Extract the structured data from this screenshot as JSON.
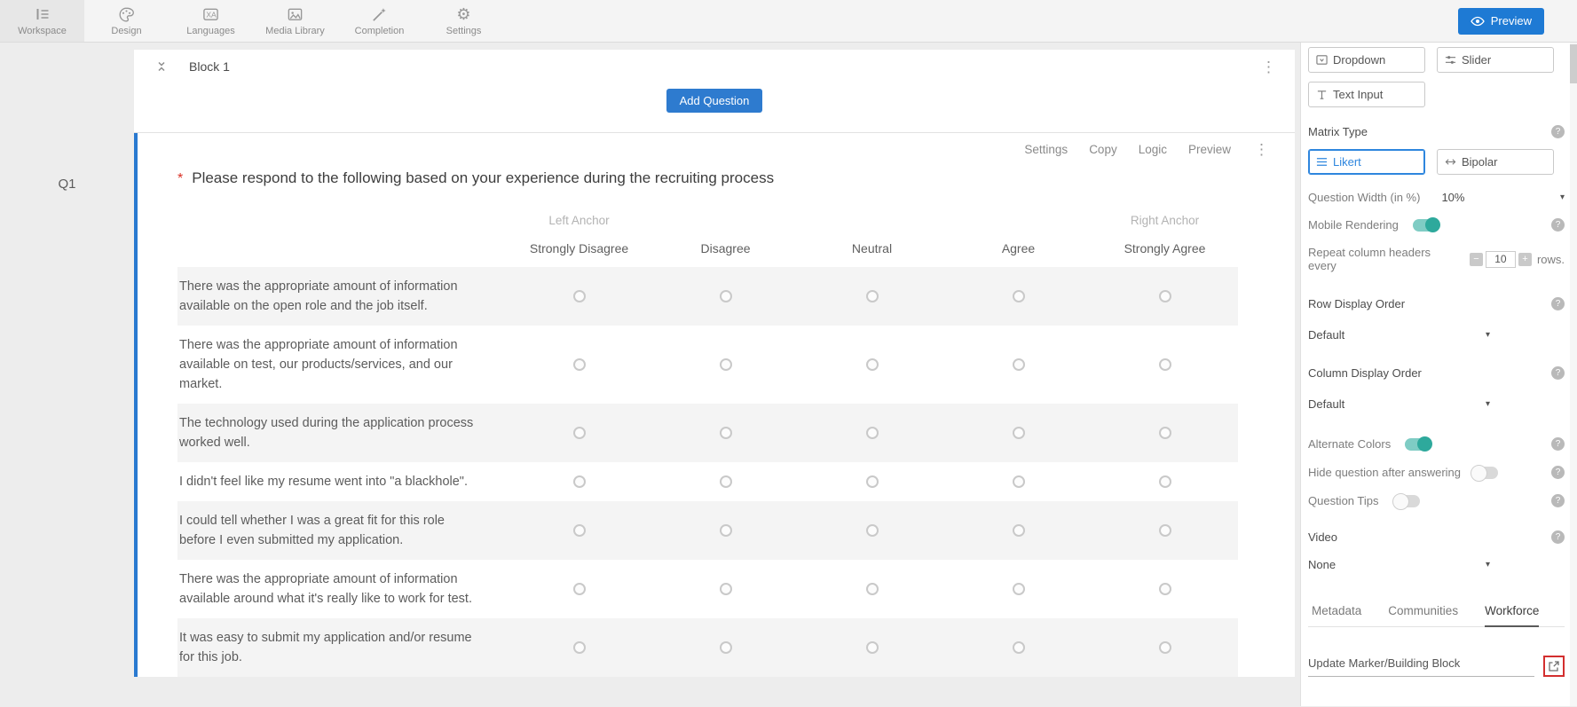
{
  "topbar": {
    "items": [
      {
        "label": "Workspace"
      },
      {
        "label": "Design"
      },
      {
        "label": "Languages"
      },
      {
        "label": "Media Library"
      },
      {
        "label": "Completion"
      },
      {
        "label": "Settings"
      }
    ],
    "preview_button": "Preview"
  },
  "block": {
    "title": "Block 1",
    "add_question_label": "Add Question"
  },
  "question": {
    "id_label": "Q1",
    "actions": [
      "Settings",
      "Copy",
      "Logic",
      "Preview"
    ],
    "required_marker": "*",
    "title": "Please respond to the following based on your experience during the recruiting process",
    "matrix": {
      "left_anchor_label": "Left Anchor",
      "right_anchor_label": "Right Anchor",
      "columns": [
        "Strongly Disagree",
        "Disagree",
        "Neutral",
        "Agree",
        "Strongly Agree"
      ],
      "rows": [
        "There was the appropriate amount of information available on the open role and the job itself.",
        "There was the appropriate amount of information available on test, our products/services, and our market.",
        "The technology used during the application process worked well.",
        "I didn't feel like my resume went into \"a blackhole\".",
        "I could tell whether I was a great fit for this role before I even submitted my application.",
        "There was the appropriate amount of information available around what it's really like to work for test.",
        "It was easy to submit my application and/or resume for this job."
      ]
    }
  },
  "sidebar": {
    "type_buttons": {
      "dropdown": "Dropdown",
      "slider": "Slider",
      "text_input": "Text Input"
    },
    "matrix_type": {
      "label": "Matrix Type",
      "likert": "Likert",
      "bipolar": "Bipolar",
      "selected": "Likert"
    },
    "question_width": {
      "label": "Question Width (in %)",
      "value": "10%"
    },
    "mobile_rendering": {
      "label": "Mobile Rendering",
      "state": "on"
    },
    "repeat_headers": {
      "label": "Repeat column headers every",
      "value": "10",
      "suffix": "rows."
    },
    "row_display_order": {
      "label": "Row Display Order",
      "value": "Default"
    },
    "column_display_order": {
      "label": "Column Display Order",
      "value": "Default"
    },
    "alternate_colors": {
      "label": "Alternate Colors",
      "state": "on"
    },
    "hide_question": {
      "label": "Hide question after answering",
      "state": "off"
    },
    "question_tips": {
      "label": "Question Tips",
      "state": "off"
    },
    "video": {
      "label": "Video",
      "value": "None"
    },
    "tabs": [
      "Metadata",
      "Communities",
      "Workforce"
    ],
    "active_tab": "Workforce",
    "update_marker_label": "Update Marker/Building Block"
  },
  "colors": {
    "primary_blue": "#1e7ad4",
    "add_button_blue": "#2e7bcf",
    "selected_blue": "#2e86de",
    "card_border_blue": "#2979d0",
    "toggle_teal": "#2ea99c",
    "required_red": "#d93025",
    "highlight_red": "#d32f2f",
    "row_alt_gray": "#f4f4f4"
  }
}
